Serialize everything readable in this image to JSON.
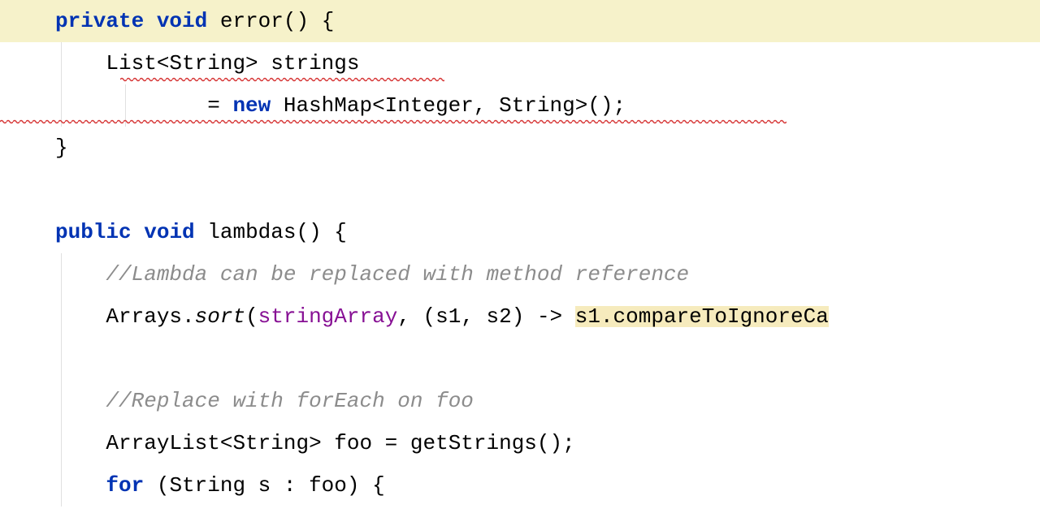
{
  "lines": {
    "l1": {
      "kw1": "private",
      "kw2": "void",
      "method": "error",
      "parens": "()",
      "brace": " {"
    },
    "l2": {
      "pre": "    ",
      "content": "List<String> strings"
    },
    "l3": {
      "pre": "            = ",
      "kw": "new",
      "rest": " HashMap<Integer, String>();"
    },
    "l4": {
      "close": "}"
    },
    "l5": {
      "kw1": "public",
      "kw2": "void",
      "method": "lambdas",
      "parens": "()",
      "brace": " {"
    },
    "l6": {
      "comment": "//Lambda can be replaced with method reference"
    },
    "l7": {
      "p1": "Arrays.",
      "sort": "sort",
      "p2": "(",
      "field": "stringArray",
      "p3": ", (s1, s2) -> ",
      "hl": "s1.compareToIgnoreCa"
    },
    "l8": {
      "comment": "//Replace with forEach on foo"
    },
    "l9": {
      "text": "ArrayList<String> foo = getStrings();"
    },
    "l10": {
      "kw": "for",
      "rest": " (String s : foo) {"
    }
  }
}
